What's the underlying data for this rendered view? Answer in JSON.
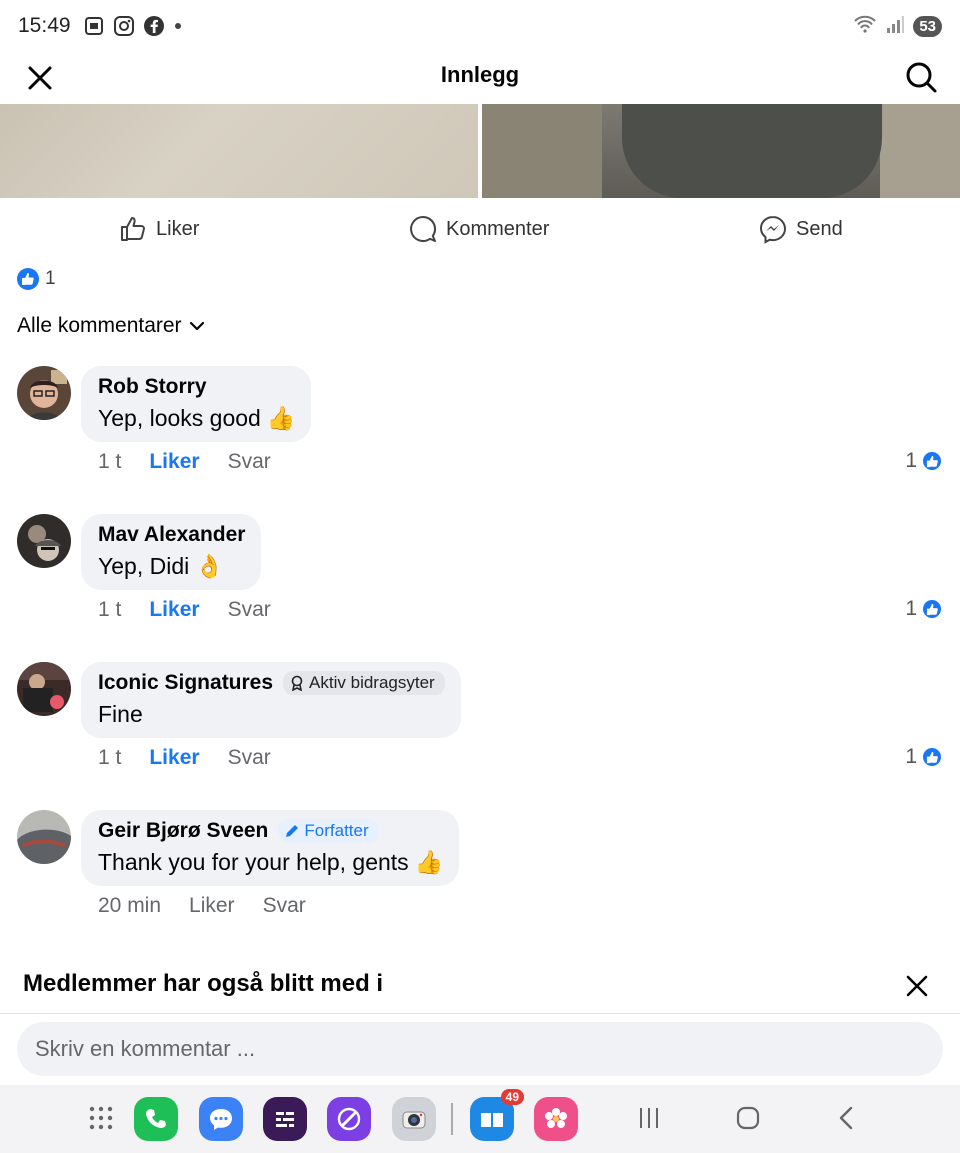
{
  "status_bar": {
    "time": "15:49",
    "battery": "53"
  },
  "header": {
    "title": "Innlegg"
  },
  "actions": {
    "like": "Liker",
    "comment": "Kommenter",
    "send": "Send"
  },
  "reactions": {
    "count": "1"
  },
  "sort": {
    "label": "Alle kommentarer"
  },
  "comments": [
    {
      "author": "Rob Storry",
      "text": "Yep, looks good",
      "emoji": "👍",
      "time": "1 t",
      "like": "Liker",
      "reply": "Svar",
      "likes": "1"
    },
    {
      "author": "Mav Alexander",
      "text": "Yep, Didi",
      "emoji": "👌",
      "time": "1 t",
      "like": "Liker",
      "reply": "Svar",
      "likes": "1"
    },
    {
      "author": "Iconic Signatures",
      "tag": "Aktiv bidragsyter",
      "text": "Fine",
      "time": "1 t",
      "like": "Liker",
      "reply": "Svar",
      "likes": "1"
    },
    {
      "author": "Geir Bjørø Sveen",
      "tag": "Forfatter",
      "text": "Thank you for your help, gents",
      "emoji": "👍",
      "time": "20 min",
      "like": "Liker",
      "reply": "Svar"
    }
  ],
  "suggestions": {
    "title": "Medlemmer har også blitt med i"
  },
  "comment_input": {
    "placeholder": "Skriv en kommentar ..."
  },
  "dock": {
    "notifications_badge": "49"
  },
  "colors": {
    "accent": "#1877f2",
    "bubble": "#f0f2f5",
    "muted": "#65676b"
  }
}
